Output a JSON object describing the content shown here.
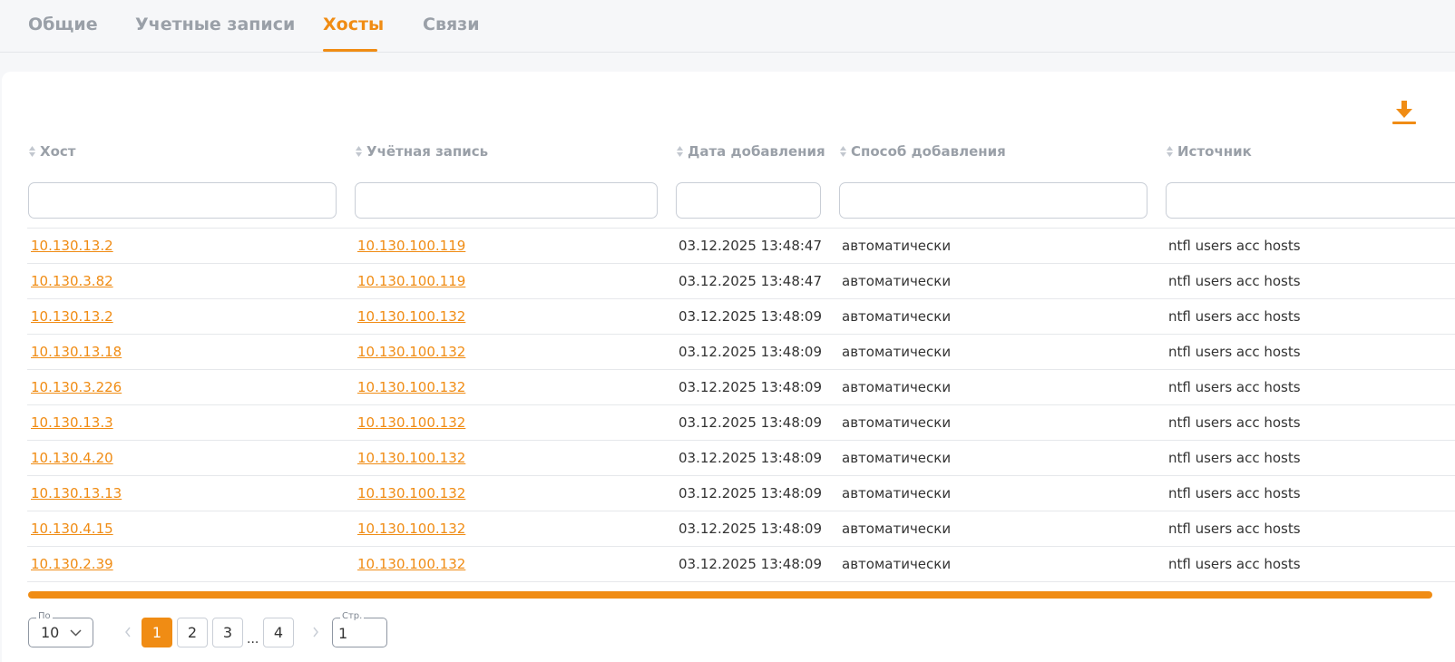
{
  "tabs": [
    {
      "label": "Общие"
    },
    {
      "label": "Учетные записи"
    },
    {
      "label": "Хосты"
    },
    {
      "label": "Связи"
    }
  ],
  "active_tab": "Хосты",
  "colors": {
    "accent": "#f08c14",
    "muted": "#9aa0a8",
    "text": "#333333"
  },
  "toolbar": {
    "download_icon": "download-icon"
  },
  "table": {
    "columns": [
      {
        "label": "Хост"
      },
      {
        "label": "Учётная запись"
      },
      {
        "label": "Дата добавления"
      },
      {
        "label": "Способ добавления"
      },
      {
        "label": "Источник"
      }
    ],
    "rows": [
      {
        "host": "10.130.13.2",
        "account": "10.130.100.119",
        "date": "03.12.2025 13:48:47",
        "method": "автоматически",
        "source": "ntfl users acc hosts"
      },
      {
        "host": "10.130.3.82",
        "account": "10.130.100.119",
        "date": "03.12.2025 13:48:47",
        "method": "автоматически",
        "source": "ntfl users acc hosts"
      },
      {
        "host": "10.130.13.2",
        "account": "10.130.100.132",
        "date": "03.12.2025 13:48:09",
        "method": "автоматически",
        "source": "ntfl users acc hosts"
      },
      {
        "host": "10.130.13.18",
        "account": "10.130.100.132",
        "date": "03.12.2025 13:48:09",
        "method": "автоматически",
        "source": "ntfl users acc hosts"
      },
      {
        "host": "10.130.3.226",
        "account": "10.130.100.132",
        "date": "03.12.2025 13:48:09",
        "method": "автоматически",
        "source": "ntfl users acc hosts"
      },
      {
        "host": "10.130.13.3",
        "account": "10.130.100.132",
        "date": "03.12.2025 13:48:09",
        "method": "автоматически",
        "source": "ntfl users acc hosts"
      },
      {
        "host": "10.130.4.20",
        "account": "10.130.100.132",
        "date": "03.12.2025 13:48:09",
        "method": "автоматически",
        "source": "ntfl users acc hosts"
      },
      {
        "host": "10.130.13.13",
        "account": "10.130.100.132",
        "date": "03.12.2025 13:48:09",
        "method": "автоматически",
        "source": "ntfl users acc hosts"
      },
      {
        "host": "10.130.4.15",
        "account": "10.130.100.132",
        "date": "03.12.2025 13:48:09",
        "method": "автоматически",
        "source": "ntfl users acc hosts"
      },
      {
        "host": "10.130.2.39",
        "account": "10.130.100.132",
        "date": "03.12.2025 13:48:09",
        "method": "автоматически",
        "source": "ntfl users acc hosts"
      }
    ]
  },
  "pagination": {
    "per_page_label": "По",
    "per_page_value": "10",
    "pages": [
      "1",
      "2",
      "3",
      "4"
    ],
    "current_page": "1",
    "ellipsis": "...",
    "page_input_label": "Стр.",
    "page_input_value": "1"
  }
}
